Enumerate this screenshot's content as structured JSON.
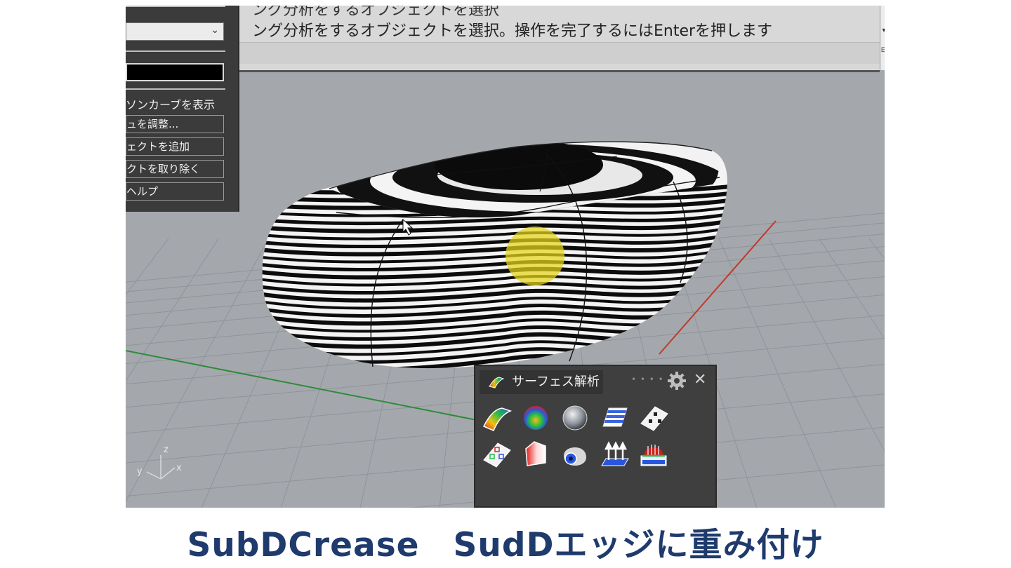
{
  "command": {
    "prev_line": "ング分析をするオブジェクトを選択",
    "prompt_line": "ング分析をするオブジェクトを選択。操作を完了するにはEnterを押します"
  },
  "left_panel": {
    "dropdown_value": "",
    "swatch_color": "#000000",
    "checkbox_label": "ソンカーブを表示",
    "buttons": [
      "ュを調整...",
      "ェクトを追加",
      "クトを取り除く",
      "ヘルプ"
    ]
  },
  "analysis_panel": {
    "title": "サーフェス解析",
    "tools": [
      "curvature-analysis-icon",
      "draft-angle-analysis-icon",
      "environment-map-icon",
      "zebra-analysis-icon",
      "point-deviation-icon",
      "edge-continuity-icon",
      "thickness-analysis-icon",
      "camera-render-icon",
      "direction-normals-icon",
      "draft-silhouette-icon"
    ]
  },
  "axis_labels": {
    "x": "x",
    "y": "y",
    "z": "z"
  },
  "colors": {
    "viewport_bg": "#a4a8ad",
    "panel_bg": "#3f3f3f",
    "caption": "#1f3b6d",
    "axis_x": "#c0392b",
    "axis_y": "#2e8b3a",
    "highlight": "#e6d51a"
  },
  "caption": "SubDCrease　SudDエッジに重み付け"
}
